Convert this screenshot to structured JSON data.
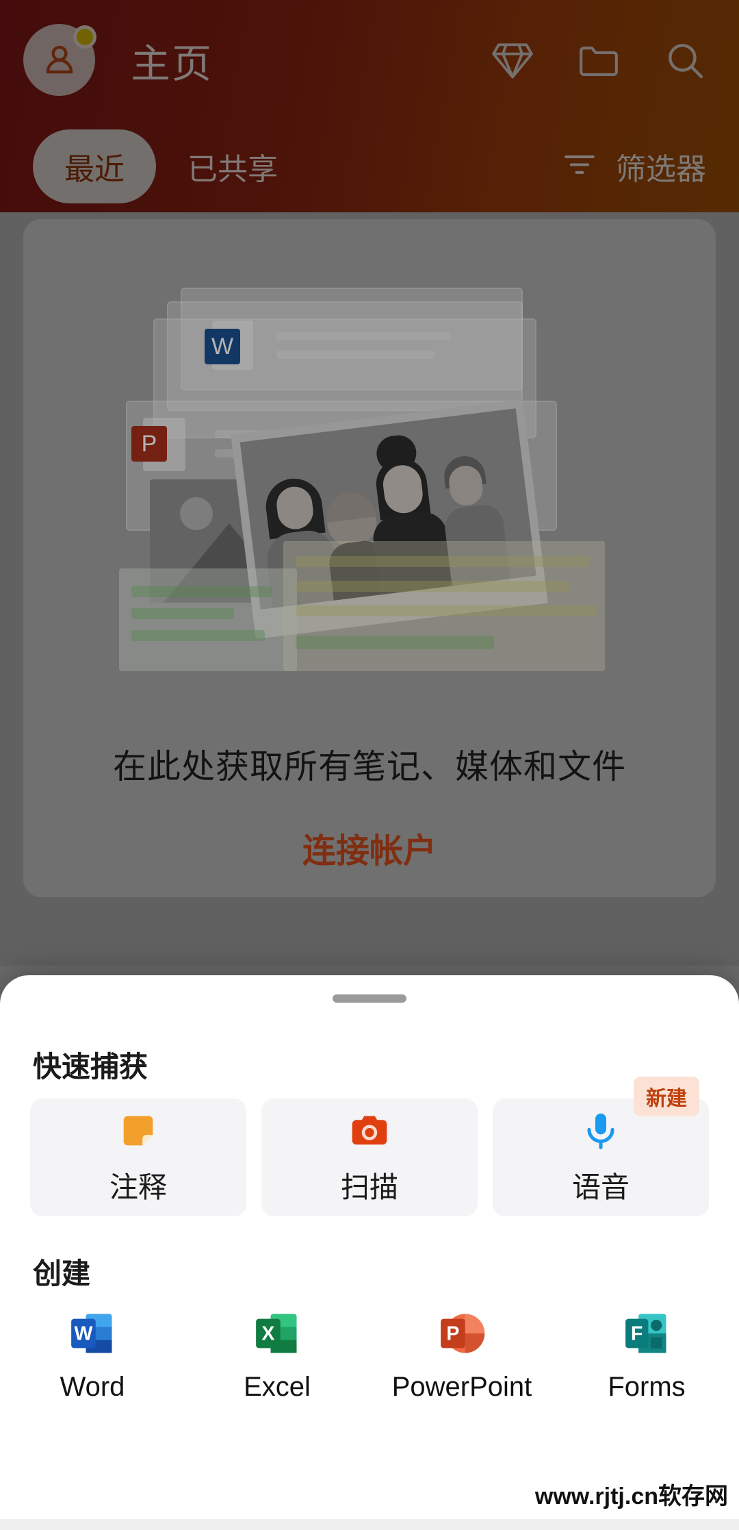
{
  "header": {
    "title": "主页",
    "avatar": {
      "icon": "account-avatar-icon",
      "badge_color": "#b8a000"
    },
    "actions": [
      {
        "name": "premium-diamond-icon",
        "label": "钻石"
      },
      {
        "name": "folder-icon",
        "label": "文件夹"
      },
      {
        "name": "search-icon",
        "label": "搜索"
      }
    ],
    "tabs": [
      {
        "label": "最近",
        "active": true
      },
      {
        "label": "已共享",
        "active": false
      }
    ],
    "filter": {
      "label": "筛选器",
      "icon": "filter-icon"
    },
    "gradient_from": "#6e1414",
    "gradient_to": "#8a4605"
  },
  "empty_state": {
    "title": "在此处获取所有笔记、媒体和文件",
    "link": "连接帐户",
    "link_color": "#b8421a",
    "illustration": {
      "word_badge": "W",
      "powerpoint_badge": "P"
    }
  },
  "sheet": {
    "quick_capture": {
      "title": "快速捕获",
      "items": [
        {
          "label": "注释",
          "icon": "sticky-note-icon",
          "color": "#f2a02b",
          "badge": null
        },
        {
          "label": "扫描",
          "icon": "camera-icon",
          "color": "#e0400f",
          "badge": null
        },
        {
          "label": "语音",
          "icon": "microphone-icon",
          "color": "#1a9af0",
          "badge": "新建"
        }
      ]
    },
    "create": {
      "title": "创建",
      "items": [
        {
          "label": "Word",
          "icon": "word-icon",
          "letter": "W",
          "color": "#185abd"
        },
        {
          "label": "Excel",
          "icon": "excel-icon",
          "letter": "X",
          "color": "#107c41"
        },
        {
          "label": "PowerPoint",
          "icon": "powerpoint-icon",
          "letter": "P",
          "color": "#c43e1c"
        },
        {
          "label": "Forms",
          "icon": "forms-icon",
          "letter": "F",
          "color": "#0b7c7c"
        }
      ]
    }
  },
  "watermark": "www.rjtj.cn软存网"
}
